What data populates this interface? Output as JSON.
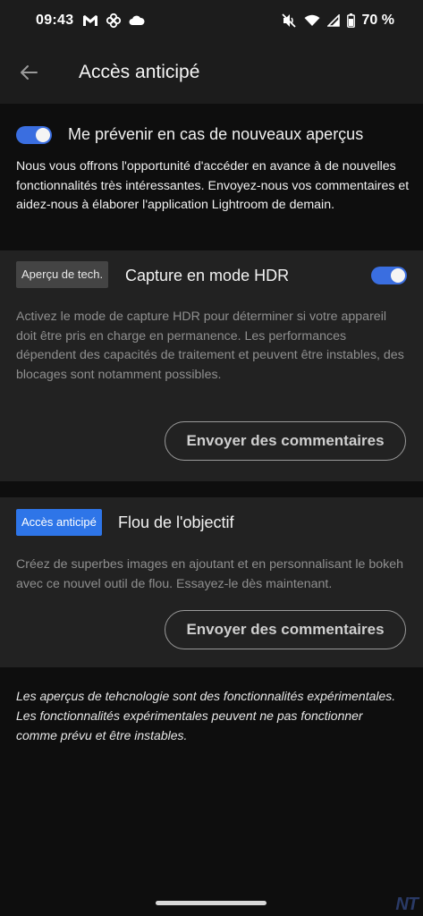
{
  "status_bar": {
    "time": "09:43",
    "battery": "70 %",
    "icons_left": [
      "gmail-icon",
      "pinwheel-icon",
      "cloud-icon"
    ],
    "icons_right": [
      "mute-icon",
      "wifi-icon",
      "signal-icon",
      "battery-icon"
    ]
  },
  "app_bar": {
    "title": "Accès anticipé",
    "back_icon": "arrow-left-icon"
  },
  "notify": {
    "label": "Me prévenir en cas de nouveaux aperçus",
    "enabled": true,
    "description": "Nous vous offrons l'opportunité d'accéder en avance à de nouvelles fonctionnalités très intéressantes. Envoyez-nous vos commentaires et aidez-nous à élaborer l'application Lightroom de demain."
  },
  "features": [
    {
      "badge": "Aperçu de tech.",
      "title": "Capture en mode HDR",
      "enabled": true,
      "description": "Activez le mode de capture HDR pour déterminer si votre appareil doit être pris en charge en permanence. Les performances dépendent des capacités de traitement et peuvent être instables, des blocages sont notamment possibles.",
      "feedback_label": "Envoyer des commentaires"
    },
    {
      "badge": "Accès anticipé",
      "title": "Flou de l'objectif",
      "description": "Créez de superbes images en ajoutant et en personnalisant le bokeh avec ce nouvel outil de flou. Essayez-le dès maintenant.",
      "feedback_label": "Envoyer des commentaires"
    }
  ],
  "footer_note": "Les aperçus de tehcnologie sont des fonctionnalités expérimentales. Les fonctionnalités expérimentales peuvent ne pas fonctionner comme prévu et être instables.",
  "watermark": "NT",
  "colors": {
    "accent": "#2e75e8",
    "toggle_on": "#3a6ee0",
    "card_bg": "#222222",
    "page_bg": "#0e0e0e"
  }
}
